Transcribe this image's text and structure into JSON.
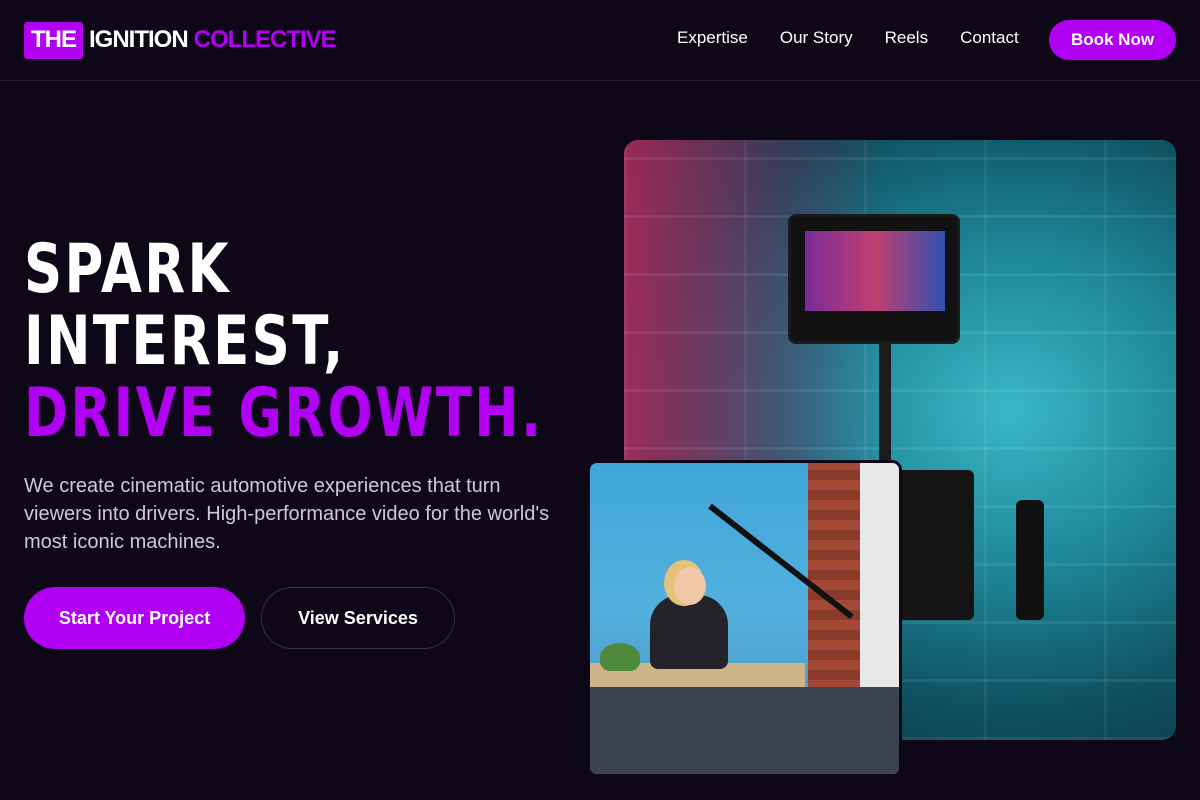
{
  "brand": {
    "part1": "THE",
    "part2": "IGNITION",
    "part3": "COLLECTIVE",
    "accent_color": "#b200f5"
  },
  "nav": {
    "links": [
      "Expertise",
      "Our Story",
      "Reels",
      "Contact"
    ],
    "cta": "Book Now"
  },
  "hero": {
    "line1": "SPARK",
    "line2": "INTEREST,",
    "line3": "DRIVE GROWTH.",
    "lede": "We create cinematic automotive experiences that turn viewers into drivers. High-performance video for the world's most iconic machines.",
    "primary_cta": "Start Your Project",
    "secondary_cta": "View Services"
  }
}
